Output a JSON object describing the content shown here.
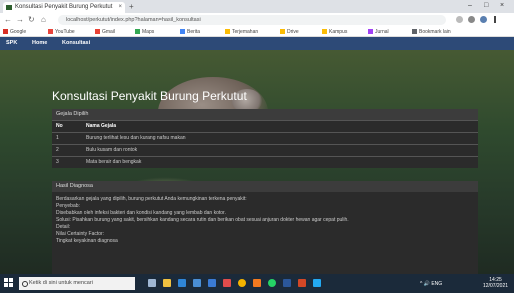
{
  "browser": {
    "tab_title": "Konsultasi Penyakit Burung Perkutut",
    "new_tab": "+",
    "window_controls": [
      "–",
      "□",
      "×"
    ],
    "nav_icons": [
      "back-icon",
      "forward-icon",
      "reload-icon",
      "home-icon"
    ],
    "url": "localhost/perkutut/index.php?halaman=hasil_konsultasi",
    "bookmarks": [
      {
        "label": "Google",
        "color": "#d93025"
      },
      {
        "label": "YouTube",
        "color": "#e8453c"
      },
      {
        "label": "Gmail",
        "color": "#ea4335"
      },
      {
        "label": "Maps",
        "color": "#34a853"
      },
      {
        "label": "Berita",
        "color": "#4285f4"
      },
      {
        "label": "Terjemahan",
        "color": "#fbbc05"
      },
      {
        "label": "Drive",
        "color": "#fbbc05"
      },
      {
        "label": "Kampus",
        "color": "#fbbc05"
      },
      {
        "label": "Jurnal",
        "color": "#a142f4"
      },
      {
        "label": "Bookmark lain",
        "color": "#5f6368"
      }
    ]
  },
  "site": {
    "nav": [
      "SPK",
      "Home",
      "Konsultasi"
    ],
    "nav_color": "#2d4a77",
    "title": "Konsultasi Penyakit Burung Perkutut"
  },
  "gejala_panel": {
    "heading": "Gejala Dipilih",
    "columns": [
      "No",
      "Nama Gejala"
    ],
    "rows": [
      {
        "no": "1",
        "gejala": "Burung terlihat lesu dan kurang nafsu makan"
      },
      {
        "no": "2",
        "gejala": "Bulu kusam dan rontok"
      },
      {
        "no": "3",
        "gejala": "Mata berair dan bengkak"
      }
    ]
  },
  "hasil_panel": {
    "heading": "Hasil Diagnosa",
    "lines": [
      "Berdasarkan gejala yang dipilih, burung perkutut Anda kemungkinan terkena penyakit:",
      "Penyebab:",
      "Disebabkan oleh infeksi bakteri dan kondisi kandang yang lembab dan kotor.",
      "Solusi: Pisahkan burung yang sakit, bersihkan kandang secara rutin dan berikan obat sesuai anjuran dokter hewan agar cepat pulih.",
      "Detail:",
      "Nilai Certainty Factor:",
      "Tingkat keyakinan diagnosa"
    ]
  },
  "taskbar": {
    "search_placeholder": "Ketik di sini untuk mencari",
    "apps": [
      {
        "name": "task-view-icon",
        "color": "#9fb7d4"
      },
      {
        "name": "file-explorer-icon",
        "color": "#f0c040"
      },
      {
        "name": "edge-icon",
        "color": "#2f86d8"
      },
      {
        "name": "store-icon",
        "color": "#4a8fd6"
      },
      {
        "name": "mail-icon",
        "color": "#3a7bd5"
      },
      {
        "name": "photos-icon",
        "color": "#e04c4c"
      },
      {
        "name": "chrome-icon",
        "color": "#f4b400"
      },
      {
        "name": "xampp-icon",
        "color": "#f37a20"
      },
      {
        "name": "whatsapp-icon",
        "color": "#25d366"
      },
      {
        "name": "word-icon",
        "color": "#2b579a"
      },
      {
        "name": "powerpoint-icon",
        "color": "#d24726"
      },
      {
        "name": "vscode-icon",
        "color": "#23a9f2"
      }
    ],
    "tray": "^ 🔊 ENG",
    "time": "14:25",
    "date": "12/07/2021"
  }
}
